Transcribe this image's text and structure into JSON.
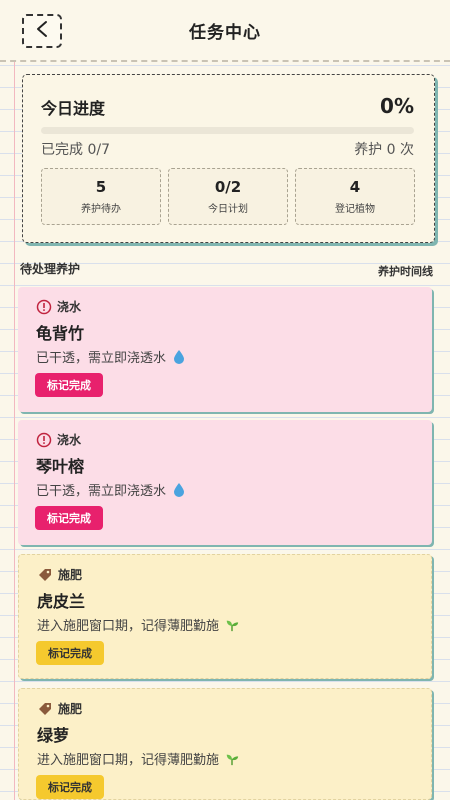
{
  "header": {
    "title": "任务中心"
  },
  "progress": {
    "title": "今日进度",
    "percent_label": "0%",
    "percent_value": 0,
    "completed_label": "已完成 0/7",
    "care_label": "养护 0 次",
    "stats": [
      {
        "value": "5",
        "label": "养护待办"
      },
      {
        "value": "0/2",
        "label": "今日计划"
      },
      {
        "value": "4",
        "label": "登记植物"
      }
    ]
  },
  "section": {
    "title": "待处理养护",
    "timeline_link": "养护时间线"
  },
  "tasks": [
    {
      "type": "浇水",
      "plant": "龟背竹",
      "note": "已干透，需立即浇透水",
      "button": "标记完成",
      "type_icon": "alert-icon",
      "note_icon": "water-drop-icon"
    },
    {
      "type": "浇水",
      "plant": "琴叶榕",
      "note": "已干透，需立即浇透水",
      "button": "标记完成",
      "type_icon": "alert-icon",
      "note_icon": "water-drop-icon"
    },
    {
      "type": "施肥",
      "plant": "虎皮兰",
      "note": "进入施肥窗口期，记得薄肥勤施",
      "button": "标记完成",
      "type_icon": "tag-icon",
      "note_icon": "seedling-icon"
    },
    {
      "type": "施肥",
      "plant": "绿萝",
      "note": "进入施肥窗口期，记得薄肥勤施",
      "button": "标记完成",
      "type_icon": "tag-icon",
      "note_icon": "seedling-icon"
    }
  ],
  "colors": {
    "accent_pink": "#e8216d",
    "accent_yellow": "#f5c92e",
    "card_pink": "#fcdde7",
    "card_yellow": "#fcf0c8",
    "shadow_teal": "#7fb5b0"
  }
}
